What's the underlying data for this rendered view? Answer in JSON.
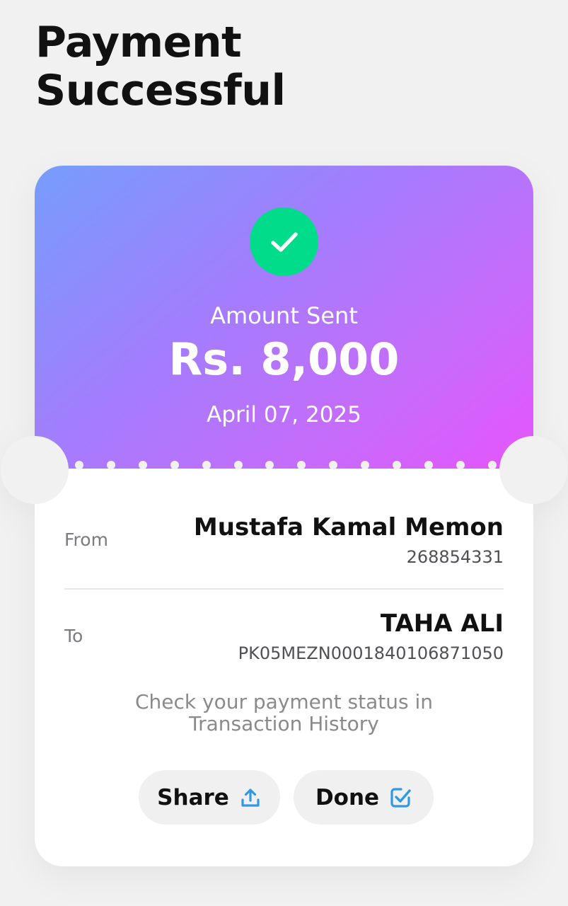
{
  "header": {
    "title_line1": "Payment",
    "title_line2": "Successful"
  },
  "receipt": {
    "amount_label": "Amount Sent",
    "amount": "Rs. 8,000",
    "date": "April 07, 2025",
    "status_icon": "check-icon",
    "from": {
      "label": "From",
      "name": "Mustafa Kamal Memon",
      "account": "268854331"
    },
    "to": {
      "label": "To",
      "name": "TAHA ALI",
      "account": "PK05MEZN0001840106871050"
    },
    "status_note_line1": "Check your payment status in",
    "status_note_line2": "Transaction History"
  },
  "actions": {
    "share_label": "Share",
    "share_icon": "upload-icon",
    "done_label": "Done",
    "done_icon": "checkbox-check-icon"
  },
  "colors": {
    "gradient_start": "#769dfd",
    "gradient_end": "#e655fb",
    "success_green": "#00dc8a",
    "icon_blue": "#2f9ae3",
    "background": "#f1f1f2"
  }
}
